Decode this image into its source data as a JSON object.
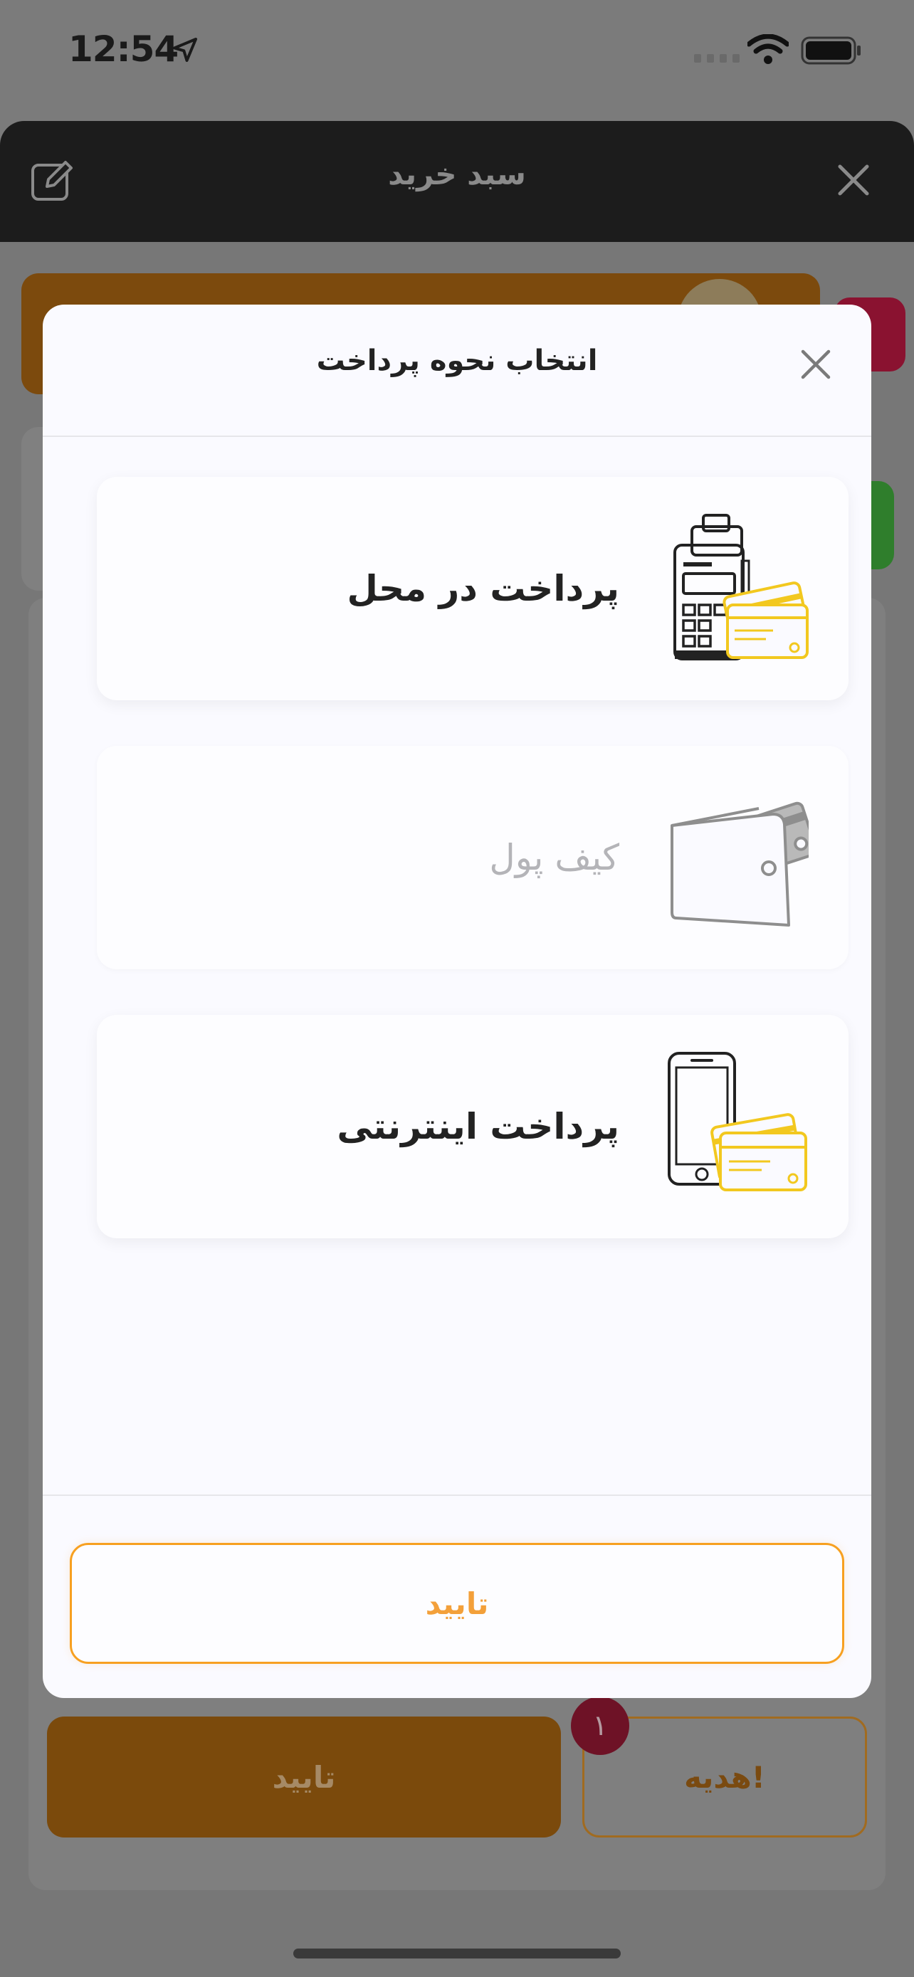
{
  "status": {
    "time": "12:54"
  },
  "cart": {
    "title": "سبد خرید"
  },
  "background": {
    "confirm_label": "تایید",
    "gift_label": "هدیه!",
    "gift_badge": "۱"
  },
  "modal": {
    "title": "انتخاب نحوه پرداخت",
    "options": [
      {
        "label": "پرداخت در محل",
        "icon": "card-pos-terminal-icon",
        "enabled": true
      },
      {
        "label": "کیف پول",
        "icon": "wallet-icon",
        "enabled": false
      },
      {
        "label": "پرداخت اینترنتی",
        "icon": "phone-card-icon",
        "enabled": true
      }
    ],
    "confirm_label": "تایید"
  },
  "colors": {
    "accent": "#f7a020",
    "card_yellow": "#f2c81f",
    "header": "#1c1c1c",
    "overlay": "#7b7b7b"
  }
}
